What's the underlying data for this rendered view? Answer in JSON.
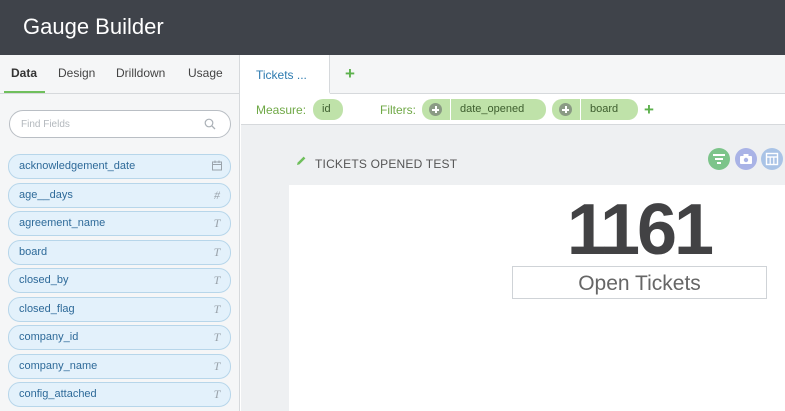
{
  "app": {
    "title": "Gauge Builder"
  },
  "sidebar": {
    "tabs": [
      {
        "label": "Data",
        "active": true
      },
      {
        "label": "Design",
        "active": false
      },
      {
        "label": "Drilldown",
        "active": false
      },
      {
        "label": "Usage",
        "active": false
      }
    ],
    "search": {
      "placeholder": "Find Fields",
      "value": "",
      "icon": "search-icon"
    },
    "fields": [
      {
        "name": "acknowledgement_date",
        "type": "date",
        "type_icon": "calendar-icon"
      },
      {
        "name": "age__days",
        "type": "number",
        "type_glyph": "#",
        "type_icon": "number-icon"
      },
      {
        "name": "agreement_name",
        "type": "text",
        "type_glyph": "T",
        "type_icon": "text-icon"
      },
      {
        "name": "board",
        "type": "text",
        "type_glyph": "T",
        "type_icon": "text-icon"
      },
      {
        "name": "closed_by",
        "type": "text",
        "type_glyph": "T",
        "type_icon": "text-icon"
      },
      {
        "name": "closed_flag",
        "type": "text",
        "type_glyph": "T",
        "type_icon": "text-icon"
      },
      {
        "name": "company_id",
        "type": "text",
        "type_glyph": "T",
        "type_icon": "text-icon"
      },
      {
        "name": "company_name",
        "type": "text",
        "type_glyph": "T",
        "type_icon": "text-icon"
      },
      {
        "name": "config_attached",
        "type": "text",
        "type_glyph": "T",
        "type_icon": "text-icon"
      }
    ]
  },
  "workspace": {
    "tab_label": "Tickets ...",
    "add_tab_symbol": "+",
    "measure": {
      "label": "Measure:",
      "value": "id"
    },
    "filters": {
      "label": "Filters:",
      "items": [
        "date_opened",
        "board"
      ],
      "add_symbol": "+"
    }
  },
  "visualization": {
    "title": "TICKETS OPENED TEST",
    "value": "1161",
    "sublabel": "Open Tickets",
    "actions": [
      {
        "icon": "filter-icon",
        "color": "#7cc48a"
      },
      {
        "icon": "camera-icon",
        "color": "#a9b3e6"
      },
      {
        "icon": "table-icon",
        "color": "#a9c3e6"
      }
    ]
  },
  "colors": {
    "titlebar": "#3f434a",
    "accent_green": "#6fbf5c",
    "field_blue": "#e3f1fb",
    "pill_green": "#bfe2a9"
  }
}
